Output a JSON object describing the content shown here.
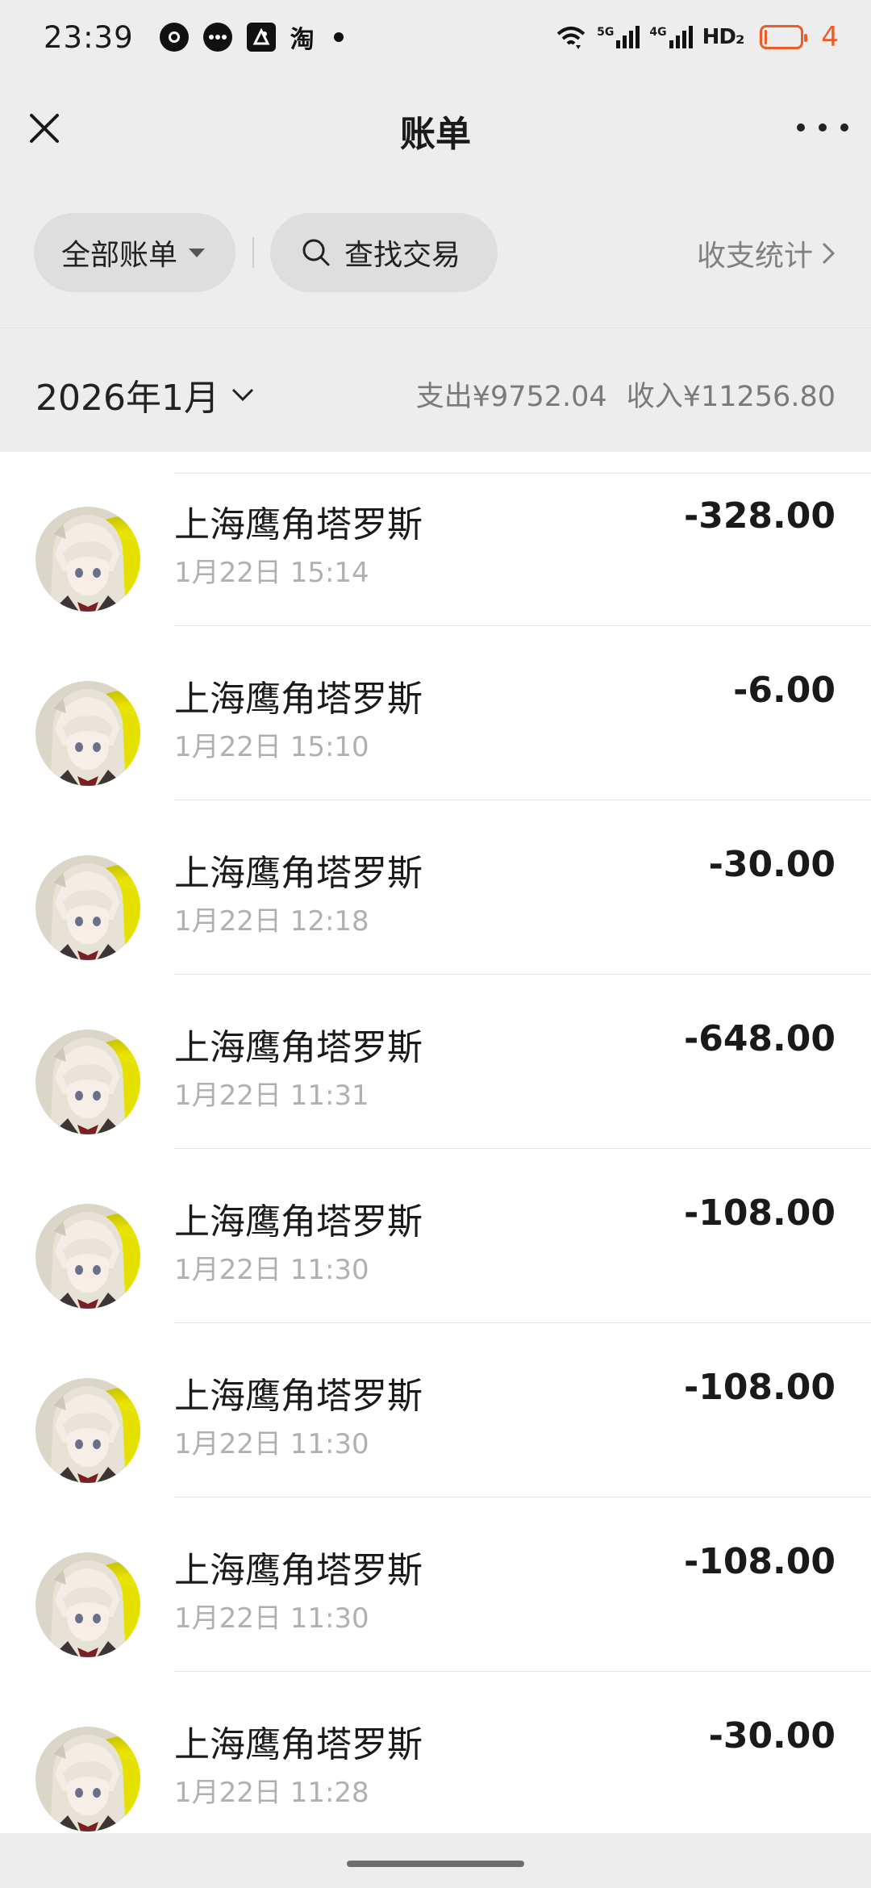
{
  "status_bar": {
    "time": "23:39",
    "left_icons": [
      "chat-bubble-icon",
      "message-icon",
      "vpn-icon",
      "taobao-icon",
      "notification-dot-icon"
    ],
    "taobao_glyph": "淘",
    "network_5g": "5G",
    "network_4g": "4G",
    "hd_label": "HD₂",
    "battery_level": "4",
    "battery_color": "#f05a24"
  },
  "header": {
    "title": "账单",
    "close_icon": "close-icon",
    "more_icon": "more-icon"
  },
  "filters": {
    "all_bills_label": "全部账单",
    "search_label": "查找交易",
    "stats_label": "收支统计"
  },
  "month_bar": {
    "month_label": "2026年1月",
    "expense_label": "支出¥9752.04",
    "income_label": "收入¥11256.80"
  },
  "transactions": [
    {
      "merchant": "上海鹰角塔罗斯",
      "time": "1月22日 15:14",
      "amount": "-328.00"
    },
    {
      "merchant": "上海鹰角塔罗斯",
      "time": "1月22日 15:10",
      "amount": "-6.00"
    },
    {
      "merchant": "上海鹰角塔罗斯",
      "time": "1月22日 12:18",
      "amount": "-30.00"
    },
    {
      "merchant": "上海鹰角塔罗斯",
      "time": "1月22日 11:31",
      "amount": "-648.00"
    },
    {
      "merchant": "上海鹰角塔罗斯",
      "time": "1月22日 11:30",
      "amount": "-108.00"
    },
    {
      "merchant": "上海鹰角塔罗斯",
      "time": "1月22日 11:30",
      "amount": "-108.00"
    },
    {
      "merchant": "上海鹰角塔罗斯",
      "time": "1月22日 11:30",
      "amount": "-108.00"
    },
    {
      "merchant": "上海鹰角塔罗斯",
      "time": "1月22日 11:28",
      "amount": "-30.00"
    }
  ]
}
